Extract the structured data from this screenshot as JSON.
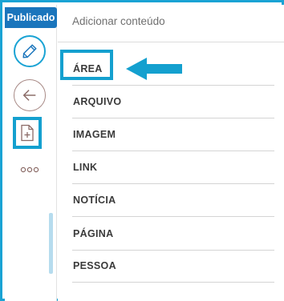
{
  "status_badge": "Publicado",
  "panel": {
    "title": "Adicionar conteúdo"
  },
  "items": [
    {
      "label": "ÁREA"
    },
    {
      "label": "ARQUIVO"
    },
    {
      "label": "IMAGEM"
    },
    {
      "label": "LINK"
    },
    {
      "label": "NOTÍCIA"
    },
    {
      "label": "PÁGINA"
    },
    {
      "label": "PESSOA"
    }
  ],
  "icons": {
    "edit": "pencil-icon",
    "back": "arrow-left-icon",
    "add": "file-plus-icon",
    "more": "more-dots-icon"
  },
  "colors": {
    "accent": "#1aa3d4",
    "badge": "#1a75bc",
    "item_text": "#3a3a3a"
  }
}
